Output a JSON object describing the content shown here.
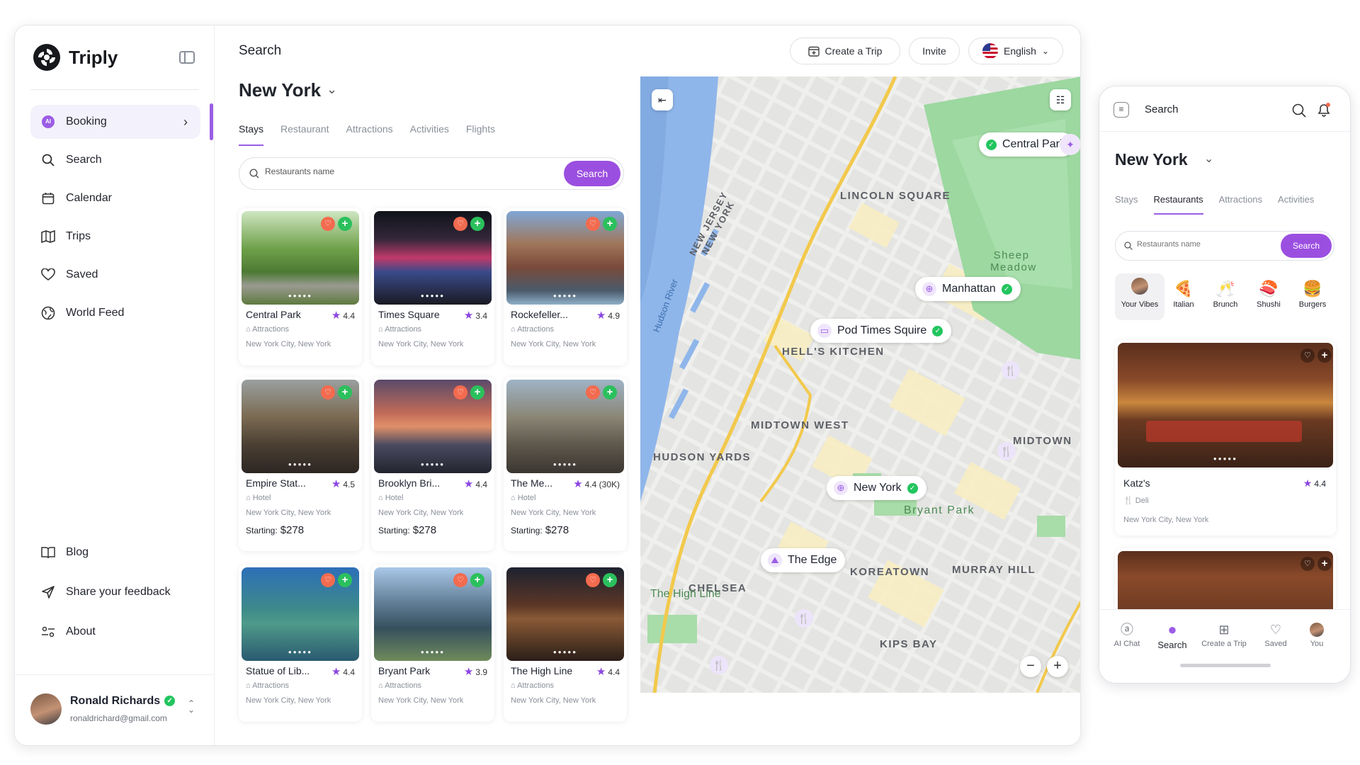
{
  "app": {
    "name": "Triply"
  },
  "sidebar": {
    "items": [
      {
        "label": "Booking"
      },
      {
        "label": "Search"
      },
      {
        "label": "Calendar"
      },
      {
        "label": "Trips"
      },
      {
        "label": "Saved"
      },
      {
        "label": "World Feed"
      }
    ],
    "bottom_items": [
      {
        "label": "Blog"
      },
      {
        "label": "Share your feedback"
      },
      {
        "label": "About"
      }
    ],
    "booking_badge": "AI",
    "user": {
      "name": "Ronald Richards",
      "email": "ronaldrichard@gmail.com"
    }
  },
  "header": {
    "page_label": "Search",
    "create_trip": "Create a Trip",
    "invite": "Invite",
    "language": "English",
    "city": "New York"
  },
  "tabs": [
    "Stays",
    "Restaurant",
    "Attractions",
    "Activities",
    "Flights"
  ],
  "search": {
    "placeholder": "Restaurants name",
    "button": "Search"
  },
  "cards": [
    {
      "name": "Central Park",
      "rating": "4.4",
      "category": "Attractions",
      "location": "New York City, New York",
      "price_label": "",
      "price": ""
    },
    {
      "name": "Times Square",
      "rating": "3.4",
      "category": "Attractions",
      "location": "New York City, New York",
      "price_label": "",
      "price": ""
    },
    {
      "name": "Rockefeller...",
      "rating": "4.9",
      "category": "Attractions",
      "location": "New York City, New York",
      "price_label": "",
      "price": ""
    },
    {
      "name": "Empire Stat...",
      "rating": "4.5",
      "category": "Hotel",
      "location": "New York City, New York",
      "price_label": "Starting:",
      "price": "$278"
    },
    {
      "name": "Brooklyn Bri...",
      "rating": "4.4",
      "category": "Hotel",
      "location": "New York City, New York",
      "price_label": "Starting:",
      "price": "$278"
    },
    {
      "name": "The Me...",
      "rating": "4.4 (30K)",
      "category": "Hotel",
      "location": "New York City, New York",
      "price_label": "Starting:",
      "price": "$278"
    },
    {
      "name": "Statue of Lib...",
      "rating": "4.4",
      "category": "Attractions",
      "location": "New York City, New York",
      "price_label": "",
      "price": ""
    },
    {
      "name": "Bryant Park",
      "rating": "3.9",
      "category": "Attractions",
      "location": "New York City, New York",
      "price_label": "",
      "price": ""
    },
    {
      "name": "The High Line",
      "rating": "4.4",
      "category": "Attractions",
      "location": "New York City, New York",
      "price_label": "",
      "price": ""
    }
  ],
  "map": {
    "pins": [
      "Central Park",
      "Manhattan",
      "Pod Times Squire",
      "New York",
      "The Edge"
    ],
    "labels": [
      "LINCOLN SQUARE",
      "HELL'S KITCHEN",
      "MIDTOWN WEST",
      "HUDSON YARDS",
      "MIDTOWN",
      "CHELSEA",
      "KOREATOWN",
      "MURRAY HILL",
      "KIPS BAY",
      "Sheep Meadow",
      "Bryant Park",
      "The High Line",
      "Hudson River",
      "NEW JERSEY",
      "NEW YORK"
    ],
    "zoom_out": "−",
    "zoom_in": "+"
  },
  "mobile": {
    "title": "Search",
    "city": "New York",
    "tabs": [
      "Stays",
      "Restaurants",
      "Attractions",
      "Activities"
    ],
    "search_placeholder": "Restaurants name",
    "search_button": "Search",
    "categories": [
      "Your Vibes",
      "Italian",
      "Brunch",
      "Shushi",
      "Burgers"
    ],
    "card": {
      "name": "Katz's",
      "rating": "4.4",
      "category": "Deli",
      "location": "New York City, New York"
    },
    "nav": [
      "AI Chat",
      "Search",
      "Create a Trip",
      "Saved",
      "You"
    ]
  },
  "colors": {
    "accent": "#9b4fe0",
    "heart": "#f36b4f",
    "add": "#2bc05d",
    "verified": "#22c55e"
  }
}
